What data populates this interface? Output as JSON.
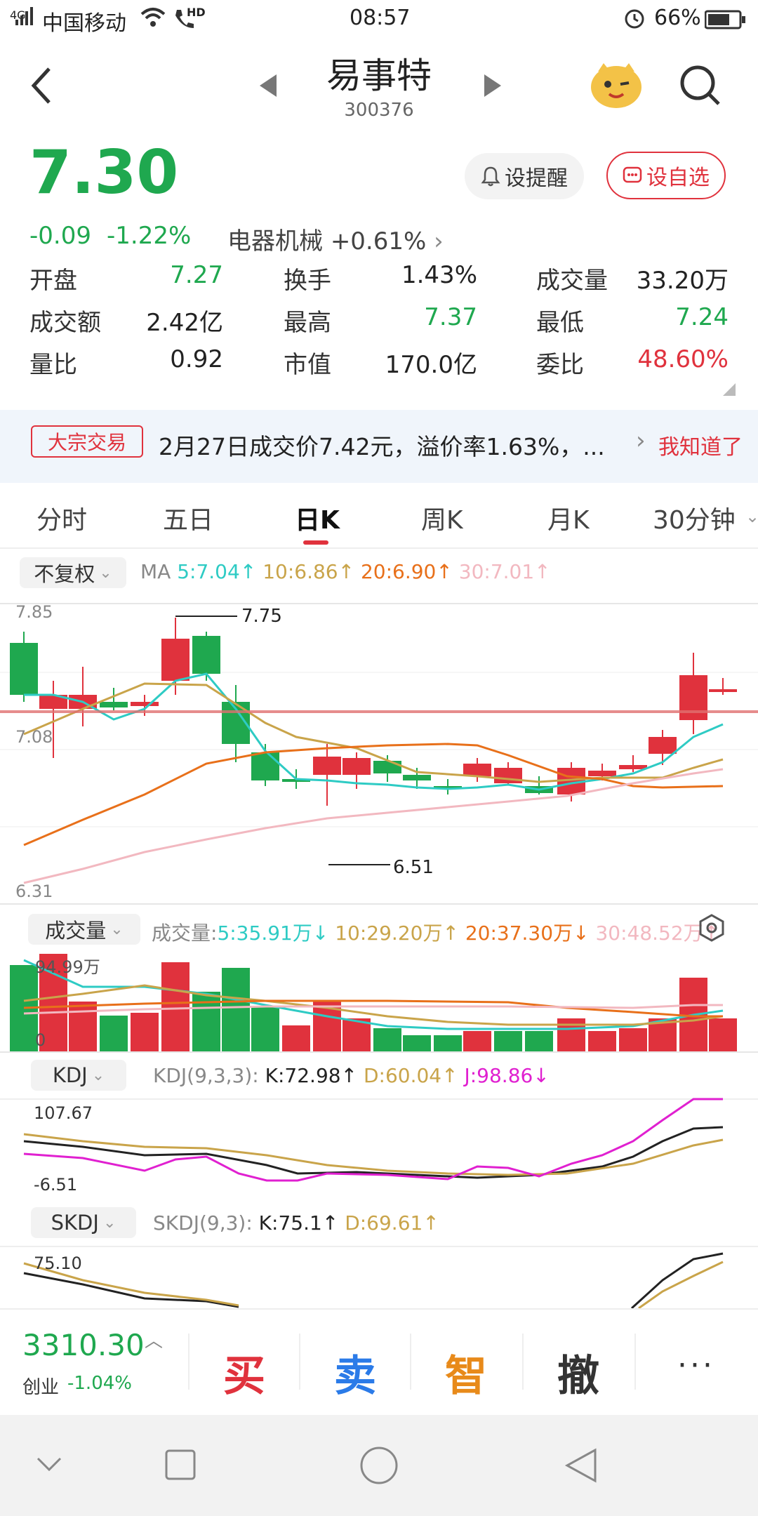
{
  "status": {
    "carrier": "中国移动",
    "signal": "4G",
    "hd": "HD",
    "time": "08:57",
    "battery": "66%"
  },
  "header": {
    "name": "易事特",
    "code": "300376"
  },
  "quote": {
    "price": "7.30",
    "change": "-0.09",
    "change_pct": "-1.22%",
    "sector": "电器机械",
    "sector_pct": "+0.61%",
    "alert_btn": "设提醒",
    "fav_btn": "设自选",
    "stats": [
      {
        "label": "开盘",
        "value": "7.27"
      },
      {
        "label": "换手",
        "value": "1.43%"
      },
      {
        "label": "成交量",
        "value": "33.20万"
      },
      {
        "label": "成交额",
        "value": "2.42亿"
      },
      {
        "label": "最高",
        "value": "7.37"
      },
      {
        "label": "最低",
        "value": "7.24"
      },
      {
        "label": "量比",
        "value": "0.92"
      },
      {
        "label": "市值",
        "value": "170.0亿"
      },
      {
        "label": "委比",
        "value": "48.60%"
      }
    ]
  },
  "notice": {
    "tag": "大宗交易",
    "text": "2月27日成交价7.42元，溢价率1.63%，...",
    "action": "我知道了"
  },
  "tabs": [
    "分时",
    "五日",
    "日K",
    "周K",
    "月K",
    "30分钟"
  ],
  "active_tab": "日K",
  "kline": {
    "adjust": "不复权",
    "ma_label": "MA",
    "ma5": "5:7.04",
    "ma10": "10:6.86",
    "ma20": "20:6.90",
    "ma30": "30:7.01",
    "ymax": "7.85",
    "ymid": "7.08",
    "ymin": "6.31",
    "high_mark": "7.75",
    "low_mark": "6.51"
  },
  "volume": {
    "title": "成交量",
    "prefix": "成交量:",
    "v5": "5:35.91万",
    "v10": "10:29.20万",
    "v20": "20:37.30万",
    "v30": "30:48.52万",
    "ymax": "94.99万",
    "ymin": "0"
  },
  "kdj": {
    "title": "KDJ",
    "params": "KDJ(9,3,3):",
    "k": "K:72.98",
    "d": "D:60.04",
    "j": "J:98.86",
    "ymax": "107.67",
    "ymin": "-6.51"
  },
  "skdj": {
    "title": "SKDJ",
    "params": "SKDJ(9,3):",
    "k": "K:75.1",
    "d": "D:69.61",
    "ymax": "75.10"
  },
  "footer": {
    "index_value": "3310.30",
    "index_name": "创业",
    "index_pct": "-1.04%",
    "buy": "买",
    "sell": "卖",
    "smart": "智",
    "cancel": "撤",
    "more": "···"
  },
  "colors": {
    "up": "#e0323d",
    "down": "#1fa84f",
    "ma5": "#2ecbc4",
    "ma10": "#c9a44a",
    "ma20": "#e8701a",
    "ma30": "#f2b8c0",
    "kdj_j": "#e020d0"
  }
}
